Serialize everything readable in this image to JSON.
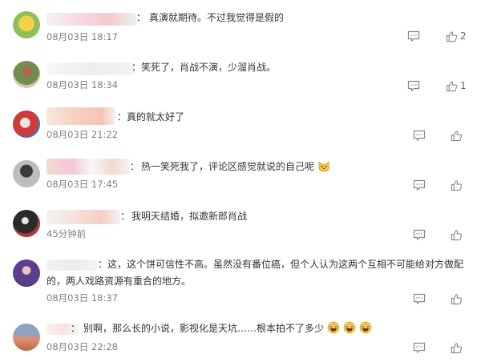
{
  "comments": [
    {
      "separator": "：",
      "text": "真演就期待。不过我觉得是假的",
      "time": "08月03日 18:17",
      "likes": "2"
    },
    {
      "separator": "：",
      "text": "笑死了，肖战不演，少溜肖战。",
      "time": "08月03日 18:34",
      "likes": "1"
    },
    {
      "separator": "：",
      "text": "真的就太好了",
      "time": "08月03日 21:22",
      "likes": ""
    },
    {
      "separator": "：",
      "text": "热一笑死我了，评论区感觉就说的自己呢",
      "time": "08月03日 17:45",
      "likes": "",
      "emoji": "cat-face-emoji"
    },
    {
      "separator": "：",
      "text": "我明天结婚，拟邀新郎肖战",
      "time": "45分钟前",
      "likes": ""
    },
    {
      "separator": "：",
      "text": "这，这个饼可信性不高。虽然没有番位癌，但个人认为这两个互相不可能给对方做配的，两人戏路资源有重合的地方。",
      "time": "08月03日 18:37",
      "likes": ""
    },
    {
      "separator": "：",
      "text": "别啊，那么长的小说，影视化是天坑……根本拍不了多少",
      "time": "08月03日 22:28",
      "likes": "",
      "emoji": "laughing-emoji"
    }
  ],
  "colors": {
    "text": "#333333",
    "time": "#808080",
    "icon": "#888888"
  }
}
